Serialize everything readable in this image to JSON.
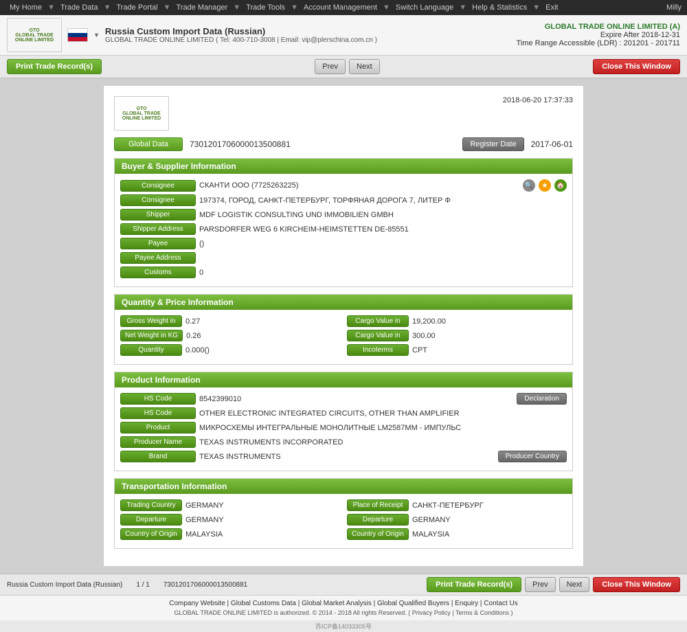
{
  "nav": {
    "items": [
      "My Home",
      "Trade Data",
      "Trade Portal",
      "Trade Manager",
      "Trade Tools",
      "Account Management",
      "Switch Language",
      "Help & Statistics",
      "Exit"
    ],
    "user": "Milly"
  },
  "header": {
    "title": "Russia Custom Import Data (Russian)",
    "company_line": "GLOBAL TRADE ONLINE LIMITED ( Tel: 400-710-3008 | Email: vip@plerschina.com.cn )",
    "brand": "GLOBAL TRADE ONLINE LIMITED (A)",
    "expire": "Expire After 2018-12-31",
    "time_range": "Time Range Accessible (LDR) : 201201 - 201711"
  },
  "toolbar": {
    "print_label": "Print Trade Record(s)",
    "prev_label": "Prev",
    "next_label": "Next",
    "close_label": "Close This Window"
  },
  "record": {
    "datetime": "2018-06-20 17:37:33",
    "global_data_label": "Global Data",
    "global_data_value": "7301201706000013500881",
    "register_date_label": "Register Date",
    "register_date_value": "2017-06-01",
    "sections": {
      "buyer_supplier": {
        "title": "Buyer & Supplier Information",
        "fields": [
          {
            "label": "Consignee",
            "value": "СКАНТИ ООО (7725263225)",
            "has_icons": true
          },
          {
            "label": "Consignee",
            "value": "197374, ГОРОД, САНКТ-ПЕТЕРБУРГ, ТОРФЯНАЯ ДОРОГА 7, ЛИТЕР Ф",
            "has_icons": false
          },
          {
            "label": "Shipper",
            "value": "MDF LOGISTIK CONSULTING UND IMMOBILIEN GMBH",
            "has_icons": false
          },
          {
            "label": "Shipper Address",
            "value": "PARSDORFER WEG 6 KIRCHEIM-HEIMSTETTEN DE-85551",
            "has_icons": false
          },
          {
            "label": "Payee",
            "value": "()",
            "has_icons": false
          },
          {
            "label": "Payee Address",
            "value": "",
            "has_icons": false
          },
          {
            "label": "Customs",
            "value": "0",
            "has_icons": false
          }
        ]
      },
      "quantity_price": {
        "title": "Quantity & Price Information",
        "rows": [
          {
            "left_label": "Gross Weight in",
            "left_value": "0.27",
            "right_label": "Cargo Value in",
            "right_value": "19,200.00"
          },
          {
            "left_label": "Net Weight in KG",
            "left_value": "0.26",
            "right_label": "Cargo Value in",
            "right_value": "300.00"
          },
          {
            "left_label": "Quantity",
            "left_value": "0.000()",
            "right_label": "Incoterms",
            "right_value": "CPT"
          }
        ]
      },
      "product": {
        "title": "Product Information",
        "fields": [
          {
            "label": "HS Code",
            "value": "8542399010",
            "extra_btn": "Declaration"
          },
          {
            "label": "HS Code",
            "value": "OTHER ELECTRONIC INTEGRATED CIRCUITS, OTHER THAN AMPLIFIER",
            "extra_btn": null
          },
          {
            "label": "Product",
            "value": "МИКРОСХЕМЫ ИНТЕГРАЛЬНЫЕ МОНОЛИТНЫЕ LM2587ММ - ИМПУЛЬС",
            "extra_btn": null
          },
          {
            "label": "Producer Name",
            "value": "TEXAS INSTRUMENTS INCORPORATED",
            "extra_btn": null
          },
          {
            "label": "Brand",
            "value": "TEXAS INSTRUMENTS",
            "extra_btn": "Producer Country"
          }
        ]
      },
      "transportation": {
        "title": "Transportation Information",
        "rows": [
          {
            "left_label": "Trading Country",
            "left_value": "GERMANY",
            "right_label": "Place of Receipt",
            "right_value": "САНКТ-ПЕТЕРБУРГ"
          },
          {
            "left_label": "Departure",
            "left_value": "GERMANY",
            "right_label": "Departure",
            "right_value": "GERMANY"
          },
          {
            "left_label": "Country of Origin",
            "left_value": "MALAYSIA",
            "right_label": "Country of Origin",
            "right_value": "MALAYSIA"
          }
        ]
      }
    }
  },
  "bottom_bar": {
    "record_type": "Russia Custom Import Data (Russian)",
    "page_info": "1 / 1",
    "record_id": "7301201706000013500881"
  },
  "footer": {
    "links": [
      "Company Website",
      "Global Customs Data",
      "Global Market Analysis",
      "Global Qualified Buyers",
      "Enquiry",
      "Contact Us"
    ],
    "copyright": "GLOBAL TRADE ONLINE LIMITED is authorized. © 2014 - 2018 All rights Reserved. ( Privacy Policy | Terms & Conditions )",
    "icp": "苏ICP备14033305号"
  }
}
